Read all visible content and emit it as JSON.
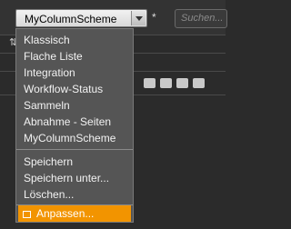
{
  "scheme_dropdown": {
    "value": "MyColumnScheme"
  },
  "modified_marker": "*",
  "search": {
    "placeholder": "Suchen..."
  },
  "menu": {
    "schemes": [
      "Klassisch",
      "Flache Liste",
      "Integration",
      "Workflow-Status",
      "Sammeln",
      "Abnahme - Seiten",
      "MyColumnScheme"
    ],
    "actions": [
      "Speichern",
      "Speichern unter...",
      "Löschen..."
    ],
    "customize_label": "Anpassen..."
  },
  "colors": {
    "highlight": "#f29400",
    "menu_bg": "#555555"
  }
}
